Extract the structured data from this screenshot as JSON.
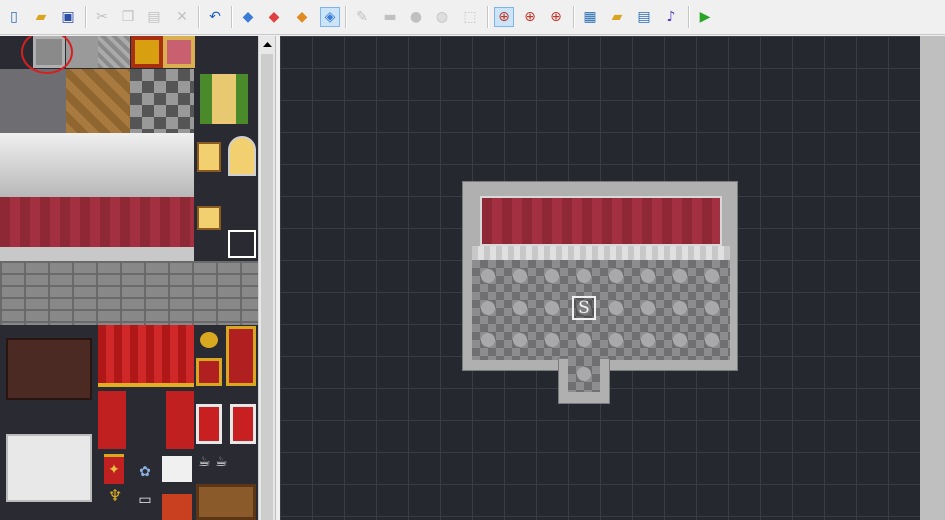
{
  "toolbar": {
    "buttons": [
      {
        "name": "new-project-button",
        "icon": "new-document-icon",
        "glyph": "▯",
        "color": "#2b6fb5",
        "active": false,
        "enabled": true
      },
      {
        "name": "open-project-button",
        "icon": "open-folder-icon",
        "glyph": "▰",
        "color": "#d9a520",
        "active": false,
        "enabled": true
      },
      {
        "name": "save-project-button",
        "icon": "save-disk-icon",
        "glyph": "▣",
        "color": "#2b4fa8",
        "active": false,
        "enabled": true
      },
      {
        "name": "cut-button",
        "icon": "scissors-icon",
        "glyph": "✂",
        "color": "#888888",
        "active": false,
        "enabled": false
      },
      {
        "name": "copy-button",
        "icon": "copy-icon",
        "glyph": "❐",
        "color": "#888888",
        "active": false,
        "enabled": false
      },
      {
        "name": "paste-button",
        "icon": "paste-icon",
        "glyph": "▤",
        "color": "#888888",
        "active": false,
        "enabled": false
      },
      {
        "name": "delete-button",
        "icon": "x-delete-icon",
        "glyph": "✕",
        "color": "#888888",
        "active": false,
        "enabled": false
      },
      {
        "name": "undo-button",
        "icon": "undo-arrow-icon",
        "glyph": "↶",
        "color": "#1f5fbf",
        "active": false,
        "enabled": true
      },
      {
        "name": "layer-1-button",
        "icon": "layer-lower-icon",
        "glyph": "◆",
        "color": "#3a7bd5",
        "active": false,
        "enabled": true
      },
      {
        "name": "layer-2-button",
        "icon": "layer-upper-icon",
        "glyph": "◆",
        "color": "#e04040",
        "active": false,
        "enabled": true
      },
      {
        "name": "layer-3-button",
        "icon": "layer-top-icon",
        "glyph": "◆",
        "color": "#e08a20",
        "active": false,
        "enabled": true
      },
      {
        "name": "event-layer-button",
        "icon": "event-cube-icon",
        "glyph": "◈",
        "color": "#3a7bd5",
        "active": true,
        "enabled": true
      },
      {
        "name": "pencil-tool-button",
        "icon": "pencil-icon",
        "glyph": "✎",
        "color": "#888888",
        "active": false,
        "enabled": false
      },
      {
        "name": "rectangle-tool-button",
        "icon": "rectangle-icon",
        "glyph": "▬",
        "color": "#888888",
        "active": false,
        "enabled": false
      },
      {
        "name": "ellipse-tool-button",
        "icon": "ellipse-icon",
        "glyph": "●",
        "color": "#888888",
        "active": false,
        "enabled": false
      },
      {
        "name": "fill-tool-button",
        "icon": "fill-bucket-icon",
        "glyph": "◍",
        "color": "#888888",
        "active": false,
        "enabled": false
      },
      {
        "name": "select-tool-button",
        "icon": "selection-marquee-icon",
        "glyph": "⬚",
        "color": "#888888",
        "active": false,
        "enabled": false
      },
      {
        "name": "zoom-1-1-button",
        "icon": "zoom-1-1-icon",
        "glyph": "⊕",
        "color": "#c0392b",
        "active": true,
        "enabled": true
      },
      {
        "name": "zoom-1-2-button",
        "icon": "zoom-1-2-icon",
        "glyph": "⊕",
        "color": "#c0392b",
        "active": false,
        "enabled": true
      },
      {
        "name": "zoom-1-4-button",
        "icon": "zoom-1-4-icon",
        "glyph": "⊕",
        "color": "#c0392b",
        "active": false,
        "enabled": true
      },
      {
        "name": "database-button",
        "icon": "database-grid-icon",
        "glyph": "▦",
        "color": "#2b6fb5",
        "active": false,
        "enabled": true
      },
      {
        "name": "material-base-button",
        "icon": "materials-folder-icon",
        "glyph": "▰",
        "color": "#d9a520",
        "active": false,
        "enabled": true
      },
      {
        "name": "script-editor-button",
        "icon": "script-page-icon",
        "glyph": "▤",
        "color": "#2b6fb5",
        "active": false,
        "enabled": true
      },
      {
        "name": "sound-test-button",
        "icon": "music-note-icon",
        "glyph": "♪",
        "color": "#5a3ab5",
        "active": false,
        "enabled": true
      },
      {
        "name": "playtest-button",
        "icon": "play-triangle-icon",
        "glyph": "▶",
        "color": "#2aa52a",
        "active": false,
        "enabled": true
      }
    ]
  },
  "palette": {
    "furniture_icons": [
      "armchair-icon",
      "chair-icon",
      "candelabra-icon",
      "open-book-icon",
      "flowers-icon",
      "teacups-icon",
      "banner-icon"
    ]
  },
  "map": {
    "start_marker": "S"
  },
  "colors": {
    "map_bg": "#262830",
    "wall_red": "#9a2c3a",
    "stone": "#8d8d8f",
    "highlight": "#d62020"
  }
}
